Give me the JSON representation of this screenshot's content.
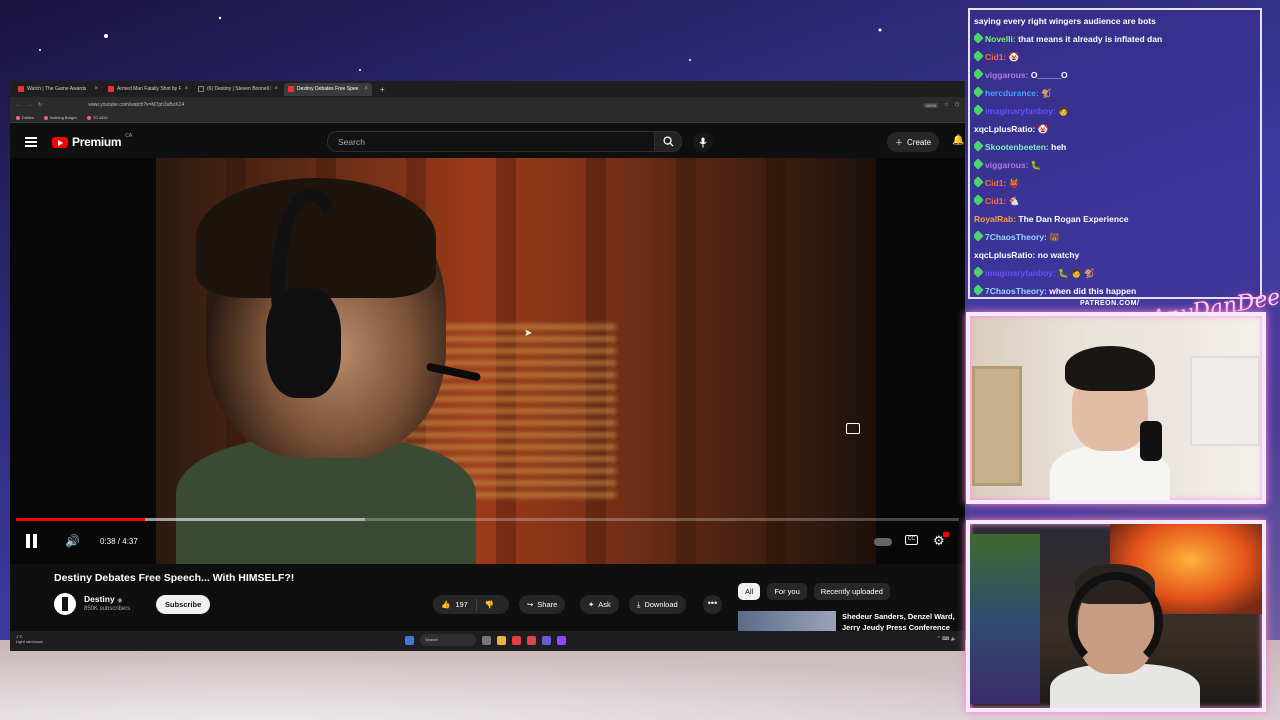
{
  "browser": {
    "tabs": [
      {
        "label": "Watch | The Game Awards",
        "active": false
      },
      {
        "label": "Armed Man Fatally Shot by Po",
        "active": false
      },
      {
        "label": "(6) Destiny | Steven Bonnell II o",
        "active": false
      },
      {
        "label": "Destiny Debates Free Spee",
        "active": true
      }
    ],
    "new_tab": "+",
    "url": "www.youtube.com/watch?v=M7ph3sBoK24",
    "zoom": "150%",
    "bookmarks": [
      "Dailies",
      "Nothing Burger",
      "TO ADD"
    ]
  },
  "youtube": {
    "logo_text": "Premium",
    "logo_region": "CA",
    "search_placeholder": "Search",
    "create_label": "Create",
    "video": {
      "title": "Destiny Debates Free Speech... With HIMSELF?!",
      "time": "0:38 / 4:37",
      "progress_fraction": 0.137,
      "buffered_fraction": 0.37
    },
    "channel": {
      "name": "Destiny",
      "verified_mark": "◉",
      "subscribers": "850K subscribers"
    },
    "subscribe_label": "Subscribe",
    "likes": "197",
    "share_label": "Share",
    "ask_label": "Ask",
    "download_label": "Download",
    "more_label": "•••",
    "chips": [
      {
        "label": "All",
        "selected": true
      },
      {
        "label": "For you",
        "selected": false
      },
      {
        "label": "Recently uploaded",
        "selected": false
      }
    ],
    "recommended_title": "Shedeur Sanders, Denzel Ward, Jerry Jeudy Press Conference"
  },
  "taskbar": {
    "weather_line1": "1°C",
    "weather_line2": "Light rain/snow",
    "search_label": "Search"
  },
  "chat": {
    "messages": [
      {
        "user": "",
        "user_color": "#ffffff",
        "badge": false,
        "text": "saying every right wingers audience are bots"
      },
      {
        "user": "Novelli:",
        "user_color": "#7cf07c",
        "badge": true,
        "text": "that means it already is inflated dan"
      },
      {
        "user": "Cid1:",
        "user_color": "#ff6a3a",
        "badge": true,
        "text": "🤡"
      },
      {
        "user": "viggarous:",
        "user_color": "#b07be0",
        "badge": true,
        "text": "O_____O"
      },
      {
        "user": "hercdurance:",
        "user_color": "#4aa0ff",
        "badge": true,
        "text": "🐒"
      },
      {
        "user": "imaginaryfanboy:",
        "user_color": "#6a4cff",
        "badge": true,
        "text": "🧑"
      },
      {
        "user": "xqcLplusRatio:",
        "user_color": "#ffffff",
        "badge": false,
        "text": "🤡"
      },
      {
        "user": "Skootenbeeten:",
        "user_color": "#7cf0c0",
        "badge": true,
        "text": "heh"
      },
      {
        "user": "viggarous:",
        "user_color": "#b07be0",
        "badge": true,
        "text": "🐛"
      },
      {
        "user": "Cid1:",
        "user_color": "#ff6a3a",
        "badge": true,
        "text": "👹"
      },
      {
        "user": "Cid1:",
        "user_color": "#ff6a3a",
        "badge": true,
        "text": "🐔"
      },
      {
        "user": "RoyalRab:",
        "user_color": "#ff9f3a",
        "badge": false,
        "text": "The Dan Rogan Experience"
      },
      {
        "user": "7ChaosTheory:",
        "user_color": "#9ad2ff",
        "badge": true,
        "text": "🐻"
      },
      {
        "user": "xqcLplusRatio:",
        "user_color": "#ffffff",
        "badge": false,
        "text": "no watchy"
      },
      {
        "user": "imaginaryfanboy:",
        "user_color": "#6a4cff",
        "badge": true,
        "text": "🐛 🧑 🐒"
      },
      {
        "user": "7ChaosTheory:",
        "user_color": "#9ad2ff",
        "badge": true,
        "text": "when did this happen"
      }
    ]
  },
  "overlay": {
    "patreon_text": "PATREON.COM/",
    "script_logo": "AnyDanDee"
  },
  "colors": {
    "youtube_red": "#ff0000",
    "frame_glow": "#ff7fd0",
    "chat_border": "#e9e0ef"
  }
}
